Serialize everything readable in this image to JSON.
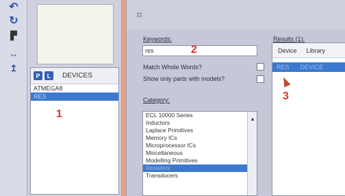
{
  "toolstrip": {
    "tools": [
      "undo-icon",
      "redo-icon",
      "pin-icon",
      "arrow-right-icon",
      "arrow-up-icon"
    ]
  },
  "devices_panel": {
    "p_button": "P",
    "l_button": "L",
    "title": "DEVICES",
    "items": [
      "ATMEGA8",
      "RES"
    ],
    "selected_index": 1
  },
  "annotations": {
    "step1": "1",
    "step2": "2",
    "step3": "3"
  },
  "pick_dialog": {
    "keywords_label": "Keywords:",
    "keywords_value": "res",
    "match_whole_words_label": "Match Whole Words?",
    "show_only_models_label": "Show only parts with models?",
    "category_label": "Category:",
    "categories": [
      "ECL 10000 Series",
      "Inductors",
      "Laplace Primitives",
      "Memory ICs",
      "Microprocessor ICs",
      "Miscellaneous",
      "Modelling Primitives",
      "Resistors",
      "Transducers"
    ],
    "selected_category_index": 7,
    "results_label": "Results (1):",
    "results_columns": [
      "Device",
      "Library"
    ],
    "results_rows": [
      {
        "device": "RES",
        "library": "DEVICE"
      }
    ]
  }
}
